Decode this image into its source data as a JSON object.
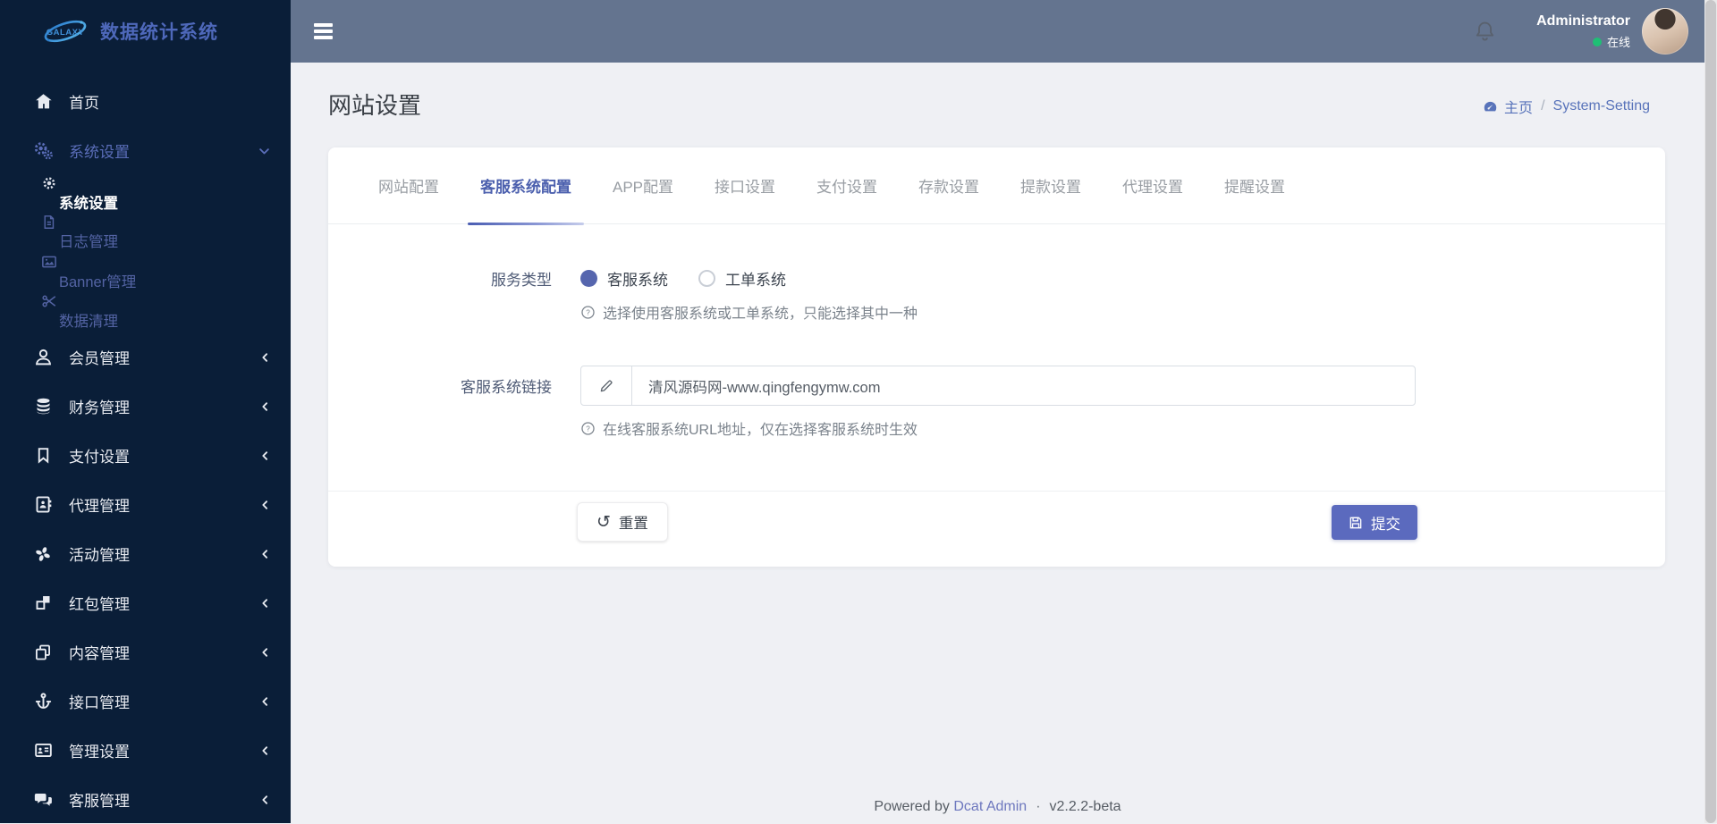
{
  "theme": {
    "sidebar_bg": "#0a1e38",
    "header_bg": "#64748f",
    "accent": "#5b6abe",
    "active_tab_color": "#4c60ae",
    "link_color": "#5873ba",
    "status_online_color": "#1fbf75",
    "radio_checked_color": "#5666ae"
  },
  "sidebar": {
    "logo_text": "GALAXY",
    "app_title": "数据统计系统",
    "items": [
      {
        "label": "首页",
        "icon": "home-icon"
      },
      {
        "label": "系统设置",
        "icon": "cogs-icon",
        "state": "expanded"
      },
      {
        "label": "系统设置",
        "icon": "gear-icon",
        "state": "active"
      },
      {
        "label": "日志管理",
        "icon": "file-text-icon"
      },
      {
        "label": "Banner管理",
        "icon": "image-icon"
      },
      {
        "label": "数据清理",
        "icon": "scissors-icon"
      },
      {
        "label": "会员管理",
        "icon": "user-icon",
        "state": "collapsed"
      },
      {
        "label": "财务管理",
        "icon": "database-icon",
        "state": "collapsed"
      },
      {
        "label": "支付设置",
        "icon": "bookmark-icon",
        "state": "collapsed"
      },
      {
        "label": "代理管理",
        "icon": "address-book-icon",
        "state": "collapsed"
      },
      {
        "label": "活动管理",
        "icon": "burst-icon",
        "state": "collapsed"
      },
      {
        "label": "红包管理",
        "icon": "cubes-icon",
        "state": "collapsed"
      },
      {
        "label": "内容管理",
        "icon": "copy-icon",
        "state": "collapsed"
      },
      {
        "label": "接口管理",
        "icon": "anchor-icon",
        "state": "collapsed"
      },
      {
        "label": "管理设置",
        "icon": "id-card-icon",
        "state": "collapsed"
      },
      {
        "label": "客服管理",
        "icon": "comments-icon",
        "state": "collapsed"
      }
    ]
  },
  "header": {
    "user_name": "Administrator",
    "user_status": "在线"
  },
  "page": {
    "title": "网站设置",
    "breadcrumb": {
      "home": "主页",
      "separator": "/",
      "current": "System-Setting"
    }
  },
  "tabs": {
    "active_index": 1,
    "items": [
      {
        "label": "网站配置"
      },
      {
        "label": "客服系统配置"
      },
      {
        "label": "APP配置"
      },
      {
        "label": "接口设置"
      },
      {
        "label": "支付设置"
      },
      {
        "label": "存款设置"
      },
      {
        "label": "提款设置"
      },
      {
        "label": "代理设置"
      },
      {
        "label": "提醒设置"
      }
    ]
  },
  "form": {
    "service_type": {
      "label": "服务类型",
      "options": [
        {
          "label": "客服系统",
          "selected": true
        },
        {
          "label": "工单系统",
          "selected": false
        }
      ],
      "help": "选择使用客服系统或工单系统，只能选择其中一种"
    },
    "service_link": {
      "label": "客服系统链接",
      "value": "清风源码网-www.qingfengymw.com",
      "help": "在线客服系统URL地址，仅在选择客服系统时生效"
    },
    "reset_label": "重置",
    "submit_label": "提交"
  },
  "footer": {
    "powered_by": "Powered by",
    "link_text": "Dcat Admin",
    "separator": "·",
    "version": "v2.2.2-beta"
  }
}
